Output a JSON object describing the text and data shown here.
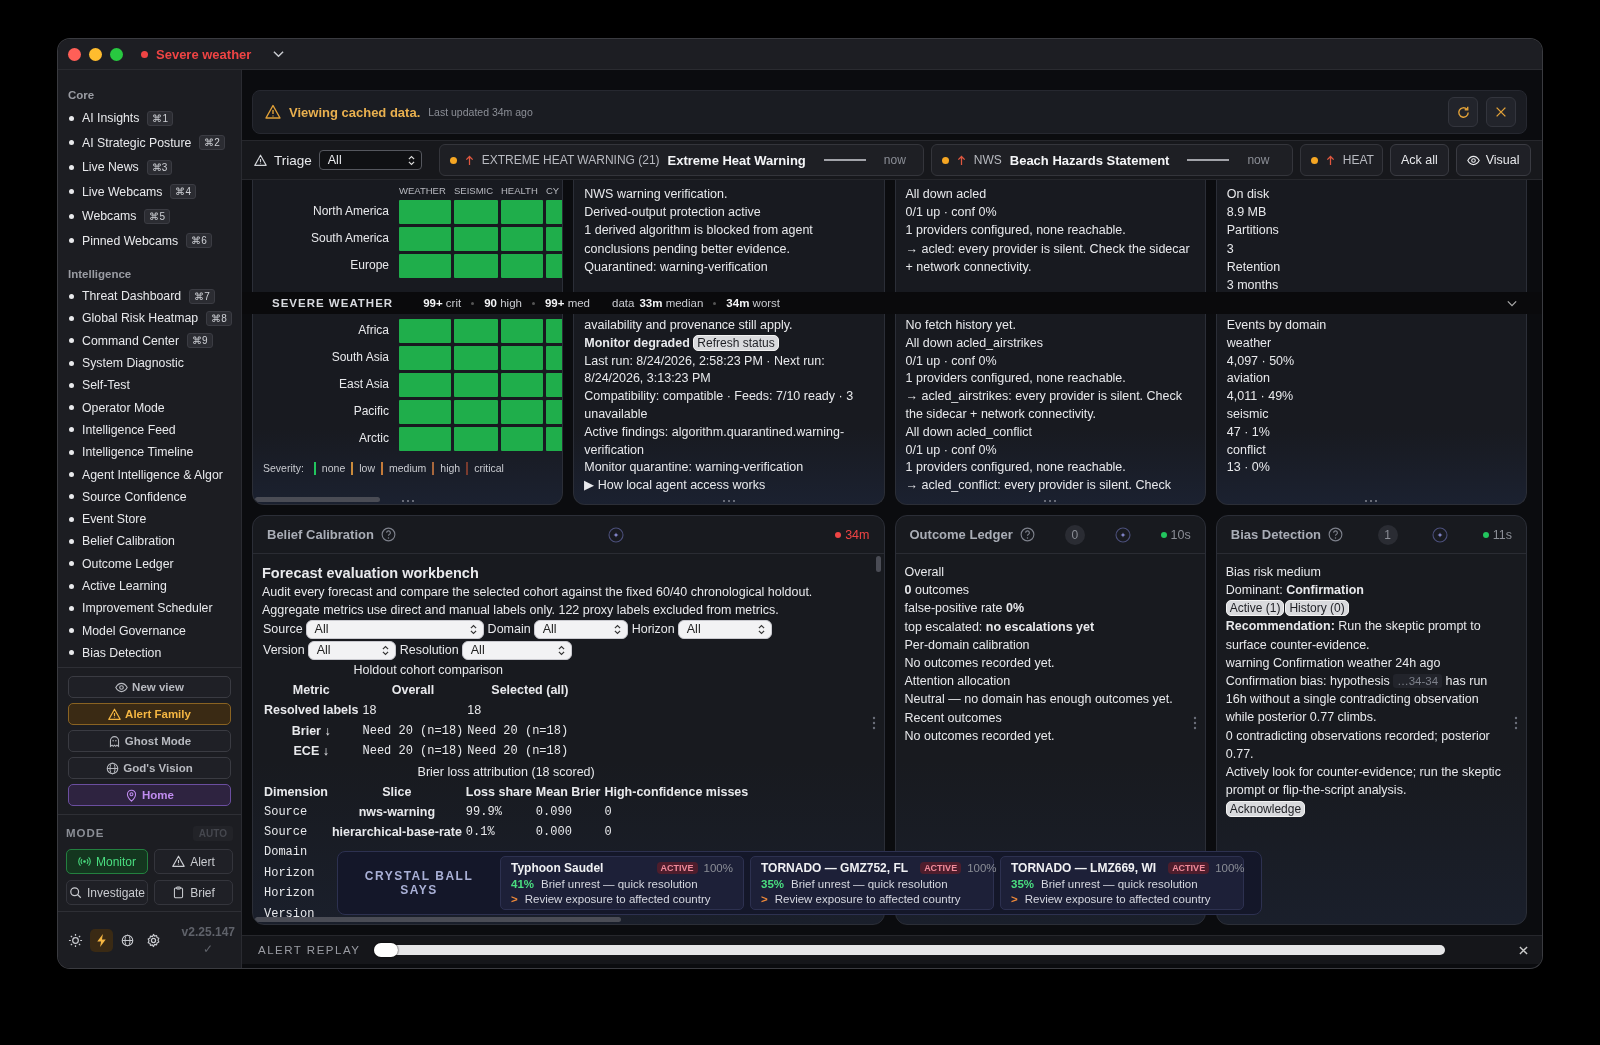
{
  "window": {
    "title": "Severe weather"
  },
  "sidebar": {
    "sections": [
      {
        "title": "Core",
        "items": [
          {
            "label": "AI Insights",
            "shortcut": "⌘1"
          },
          {
            "label": "AI Strategic Posture",
            "shortcut": "⌘2"
          },
          {
            "label": "Live News",
            "shortcut": "⌘3"
          },
          {
            "label": "Live Webcams",
            "shortcut": "⌘4"
          },
          {
            "label": "Webcams",
            "shortcut": "⌘5"
          },
          {
            "label": "Pinned Webcams",
            "shortcut": "⌘6"
          }
        ]
      },
      {
        "title": "Intelligence",
        "items": [
          {
            "label": "Threat Dashboard",
            "shortcut": "⌘7"
          },
          {
            "label": "Global Risk Heatmap",
            "shortcut": "⌘8"
          },
          {
            "label": "Command Center",
            "shortcut": "⌘9"
          },
          {
            "label": "System Diagnostic"
          },
          {
            "label": "Self-Test"
          },
          {
            "label": "Operator Mode"
          },
          {
            "label": "Intelligence Feed"
          },
          {
            "label": "Intelligence Timeline"
          },
          {
            "label": "Agent Intelligence & Algor"
          },
          {
            "label": "Source Confidence"
          },
          {
            "label": "Event Store"
          },
          {
            "label": "Belief Calibration"
          },
          {
            "label": "Outcome Ledger"
          },
          {
            "label": "Active Learning"
          },
          {
            "label": "Improvement Scheduler"
          },
          {
            "label": "Model Governance"
          },
          {
            "label": "Bias Detection"
          }
        ]
      }
    ],
    "views": [
      {
        "label": "New view",
        "kind": "eye"
      },
      {
        "label": "Alert Family",
        "kind": "warning"
      },
      {
        "label": "Ghost Mode",
        "kind": "ghost"
      },
      {
        "label": "God's Vision",
        "kind": "globe"
      },
      {
        "label": "Home",
        "kind": "pin"
      }
    ],
    "mode": {
      "title": "MODE",
      "auto": "AUTO",
      "options": [
        {
          "label": "Monitor",
          "kind": "broadcast",
          "selected": true
        },
        {
          "label": "Alert",
          "kind": "warning",
          "selected": false
        },
        {
          "label": "Investigate",
          "kind": "search",
          "selected": false
        },
        {
          "label": "Brief",
          "kind": "clipboard",
          "selected": false
        }
      ]
    },
    "footer": {
      "tools": [
        {
          "kind": "sun",
          "selected": false
        },
        {
          "kind": "bolt",
          "selected": true
        },
        {
          "kind": "globe",
          "selected": false
        },
        {
          "kind": "gear",
          "selected": false
        }
      ],
      "version": "v2.25.147",
      "status": "✓"
    }
  },
  "banner": {
    "title": "Viewing cached data.",
    "detail": "Last updated 34m ago"
  },
  "triage": {
    "label": "Triage",
    "filter": "All",
    "alerts": [
      {
        "category": "EXTREME HEAT WARNING (21)",
        "title": "Extreme Heat Warning",
        "time": "now"
      },
      {
        "category": "NWS",
        "title": "Beach Hazards Statement",
        "time": "now"
      },
      {
        "category": "HEAT"
      }
    ],
    "actions": [
      {
        "label": "Ack all",
        "kind": "plain"
      },
      {
        "label": "Visual",
        "kind": "eye"
      }
    ]
  },
  "status_strip": {
    "title": "SEVERE WEATHER",
    "counts": [
      {
        "value": "99+",
        "label": "crit"
      },
      {
        "value": "90",
        "label": "high"
      },
      {
        "value": "99+",
        "label": "med"
      }
    ],
    "data_label": "data",
    "freshness": [
      {
        "value": "33m",
        "label": "median"
      },
      {
        "value": "34m",
        "label": "worst"
      }
    ]
  },
  "panels": [
    {
      "kind": "heatmap",
      "columns": [
        "WEATHER",
        "SEISMIC",
        "HEALTH",
        "CY"
      ],
      "upper_rows": [
        {
          "label": "North America",
          "cells": [
            {
              "color": "#1fae4b"
            },
            {
              "color": "#1fae4b"
            },
            {
              "color": "#1fae4b"
            },
            {
              "color": "#1fae4b"
            }
          ]
        },
        {
          "label": "South America",
          "cells": [
            {
              "color": "#1fae4b"
            },
            {
              "color": "#1fae4b"
            },
            {
              "color": "#1fae4b"
            },
            {
              "color": "#1fae4b"
            }
          ]
        },
        {
          "label": "Europe",
          "cells": [
            {
              "color": "#1fae4b"
            },
            {
              "color": "#1fae4b"
            },
            {
              "color": "#1fae4b"
            },
            {
              "color": "#1fae4b"
            }
          ]
        }
      ],
      "lower_rows": [
        {
          "label": "Africa",
          "cells": [
            {
              "color": "#1fae4b"
            },
            {
              "color": "#1fae4b"
            },
            {
              "color": "#1fae4b"
            },
            {
              "color": "#1fae4b"
            }
          ]
        },
        {
          "label": "South Asia",
          "cells": [
            {
              "color": "#1fae4b"
            },
            {
              "color": "#1fae4b"
            },
            {
              "color": "#1fae4b"
            },
            {
              "color": "#1fae4b"
            }
          ]
        },
        {
          "label": "East Asia",
          "cells": [
            {
              "color": "#1fae4b"
            },
            {
              "color": "#1fae4b"
            },
            {
              "color": "#1fae4b"
            },
            {
              "color": "#1fae4b"
            }
          ]
        },
        {
          "label": "Pacific",
          "cells": [
            {
              "color": "#1fae4b"
            },
            {
              "color": "#1fae4b"
            },
            {
              "color": "#1fae4b"
            },
            {
              "color": "#1fae4b"
            }
          ]
        },
        {
          "label": "Arctic",
          "cells": [
            {
              "color": "#1fae4b"
            },
            {
              "color": "#1fae4b"
            },
            {
              "color": "#1fae4b"
            },
            {
              "color": "#1fae4b"
            }
          ]
        }
      ],
      "legend_label": "Severity:",
      "legend": [
        {
          "label": "none",
          "color": "#22c55e"
        },
        {
          "label": "low",
          "color": "#c98a3c"
        },
        {
          "label": "medium",
          "color": "#c47b3a"
        },
        {
          "label": "high",
          "color": "#a8673c"
        },
        {
          "label": "critical",
          "color": "#7a3b2e"
        }
      ]
    },
    {
      "kind": "text",
      "upper": [
        "NWS warning verification.",
        "Derived-output protection active",
        "1 derived algorithm is blocked from agent conclusions pending better evidence.",
        "Quarantined: warning-verification"
      ],
      "lower": [
        "availability and provenance still apply.",
        {
          "kind": "status",
          "text": "Monitor degraded",
          "action": "Refresh status"
        },
        "Last run: 8/24/2026, 2:58:23 PM · Next run: 8/24/2026, 3:13:23 PM",
        "Compatibility: compatible · Feeds: 7/10 ready · 3 unavailable",
        "Active findings: algorithm.quarantined.warning-verification",
        "Monitor quarantine: warning-verification",
        {
          "kind": "disclosure",
          "marker": "▶",
          "text": "How local agent access works"
        }
      ]
    },
    {
      "kind": "text",
      "upper": [
        "All down acled",
        "0/1 up · conf 0%",
        "1 providers configured, none reachable.",
        "→ acled: every provider is silent. Check the sidecar + network connectivity."
      ],
      "lower": [
        "No fetch history yet.",
        "All down acled_airstrikes",
        "0/1 up · conf 0%",
        "1 providers configured, none reachable.",
        "→ acled_airstrikes: every provider is silent. Check the sidecar + network connectivity.",
        "All down acled_conflict",
        "0/1 up · conf 0%",
        "1 providers configured, none reachable.",
        "→ acled_conflict: every provider is silent. Check"
      ]
    },
    {
      "kind": "text",
      "upper": [
        "On disk",
        "8.9 MB",
        "Partitions",
        "3",
        "Retention",
        "3 months"
      ],
      "lower": [
        "Events by domain",
        "weather",
        "4,097 · 50%",
        "aviation",
        "4,011 · 49%",
        "seismic",
        "47 · 1%",
        "conflict",
        "13 · 0%"
      ]
    }
  ],
  "belief": {
    "title": "Belief Calibration",
    "age": "34m",
    "color": "#ef4444",
    "heading": "Forecast evaluation workbench",
    "description": "Audit every forecast and compare the selected cohort against the fixed 60/40 chronological holdout. Aggregate metrics use direct and manual labels only. 122 proxy labels excluded from metrics.",
    "filters": [
      {
        "label": "Source",
        "value": "All"
      },
      {
        "label": "Domain",
        "value": "All"
      },
      {
        "label": "Horizon",
        "value": "All"
      },
      {
        "label": "Version",
        "value": "All"
      },
      {
        "label": "Resolution",
        "value": "All"
      }
    ],
    "holdout": {
      "title": "Holdout cohort comparison",
      "columns": [
        "Metric",
        "Overall",
        "Selected (all)"
      ],
      "rows": [
        [
          "Resolved labels",
          "18",
          "18"
        ],
        [
          "Brier ↓",
          "Need 20 (n=18)",
          "Need 20 (n=18)"
        ],
        [
          "ECE ↓",
          "Need 20 (n=18)",
          "Need 20 (n=18)"
        ]
      ]
    },
    "attribution": {
      "title": "Brier loss attribution (18 scored)",
      "columns": [
        "Dimension",
        "Slice",
        "Loss share",
        "Mean Brier",
        "High-confidence misses"
      ],
      "rows": [
        [
          "Source",
          "nws-warning",
          "99.9%",
          "0.090",
          "0"
        ],
        [
          "Source",
          "hierarchical-base-rate",
          "0.1%",
          "0.000",
          "0"
        ],
        [
          "Domain"
        ],
        [
          "Horizon"
        ],
        [
          "Horizon"
        ],
        [
          "Version"
        ]
      ]
    }
  },
  "outcome": {
    "title": "Outcome Ledger",
    "count": "0",
    "age": "10s",
    "color": "#22c55e",
    "lines": [
      "Overall",
      "**0** outcomes",
      "false-positive rate **0%**",
      "top escalated: **no escalations yet**",
      "Per-domain calibration",
      "No outcomes recorded yet.",
      "Attention allocation",
      "Neutral — no domain has enough outcomes yet.",
      "Recent outcomes",
      "No outcomes recorded yet."
    ]
  },
  "bias": {
    "title": "Bias Detection",
    "count": "1",
    "age": "11s",
    "color": "#22c55e",
    "summary": [
      "Bias risk medium",
      "Dominant: **Confirmation**"
    ],
    "tabs": [
      "Active (1)",
      "History (0)"
    ],
    "recommendation": "**Recommendation:** Run the skeptic prompt to surface counter-evidence.",
    "signal": "warning Confirmation weather 24h ago",
    "finding": {
      "before": "Confirmation bias: hypothesis",
      "code": "…34-34",
      "after": "has run 16h without a single contradicting observation while posterior 0.77 climbs."
    },
    "details": [
      "0 contradicting observations recorded; posterior 0.77.",
      "Actively look for counter-evidence; run the skeptic prompt or flip-the-script analysis."
    ],
    "action": "Acknowledge"
  },
  "crystal_ball": {
    "title": "CRYSTAL BALL SAYS",
    "predictions": [
      {
        "title": "Typhoon Saudel",
        "status": "ACTIVE",
        "confidence": "100%",
        "probability": "41%",
        "outcome": "Brief unrest — quick resolution",
        "marker": ">",
        "advice": "Review exposure to affected country"
      },
      {
        "title": "TORNADO — GMZ752, FL",
        "status": "ACTIVE",
        "confidence": "100%",
        "probability": "35%",
        "outcome": "Brief unrest — quick resolution",
        "marker": ">",
        "advice": "Review exposure to affected country"
      },
      {
        "title": "TORNADO — LMZ669, WI",
        "status": "ACTIVE",
        "confidence": "100%",
        "probability": "35%",
        "outcome": "Brief unrest — quick resolution",
        "marker": ">",
        "advice": "Review exposure to affected country"
      }
    ]
  },
  "replay": {
    "label": "ALERT REPLAY",
    "level": 0
  }
}
